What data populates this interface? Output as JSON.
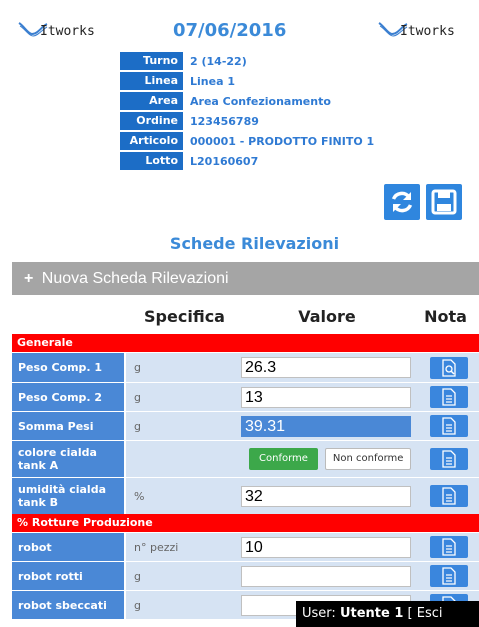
{
  "header": {
    "logo_text": "Itworks",
    "date": "07/06/2016"
  },
  "info": [
    {
      "key": "Turno",
      "value": "2 (14-22)"
    },
    {
      "key": "Linea",
      "value": "Linea 1"
    },
    {
      "key": "Area",
      "value": "Area Confezionamento"
    },
    {
      "key": "Ordine",
      "value": "123456789"
    },
    {
      "key": "Articolo",
      "value": "000001 - PRODOTTO FINITO 1"
    },
    {
      "key": "Lotto",
      "value": "L20160607"
    }
  ],
  "toolbar": {
    "refresh_icon": "refresh-icon",
    "save_icon": "save-icon"
  },
  "section_title": "Schede Rilevazioni",
  "new_sheet": {
    "plus": "+",
    "label": "Nuova Scheda Rilevazioni"
  },
  "table": {
    "headers": {
      "spec": "Specifica",
      "value": "Valore",
      "note": "Nota"
    },
    "groups": [
      {
        "title": "Generale",
        "rows": [
          {
            "label": "Peso Comp. 1",
            "spec": "g",
            "value": "26.3",
            "note_icon": "document-search-icon"
          },
          {
            "label": "Peso Comp. 2",
            "spec": "g",
            "value": "13",
            "note_icon": "document-icon"
          },
          {
            "label": "Somma Pesi",
            "spec": "g",
            "value": "39.31",
            "note_icon": "document-icon"
          },
          {
            "label": "colore cialda tank A",
            "spec": "",
            "ok_label": "Conforme",
            "ko_label": "Non conforme",
            "note_icon": "document-icon"
          },
          {
            "label": "umidità cialda tank B",
            "spec": "%",
            "value": "32",
            "note_icon": "document-icon"
          }
        ]
      },
      {
        "title": "% Rotture Produzione",
        "rows": [
          {
            "label": "robot",
            "spec": "n° pezzi",
            "value": "10",
            "note_icon": "document-icon"
          },
          {
            "label": "robot rotti",
            "spec": "g",
            "value": "",
            "note_icon": "document-icon"
          },
          {
            "label": "robot sbeccati",
            "spec": "g",
            "value": "",
            "note_icon": "document-icon"
          }
        ]
      }
    ]
  },
  "user": {
    "prefix": "User:",
    "name": "Utente 1",
    "logout": "[ Esci"
  },
  "colors": {
    "primary": "#1c6dc6",
    "accent": "#3b8ad8",
    "group": "#ff0000",
    "ok": "#3ca84a"
  }
}
